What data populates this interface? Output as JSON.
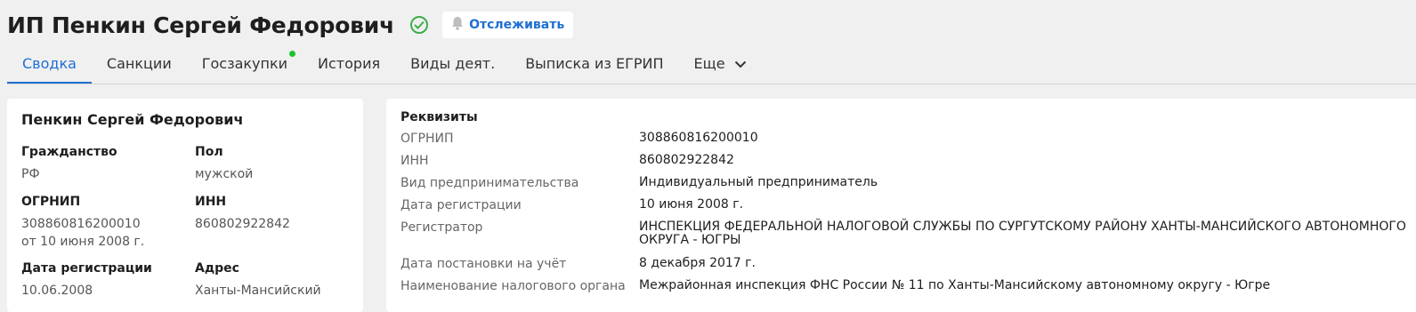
{
  "header": {
    "title": "ИП Пенкин Сергей Федорович",
    "track_label": "Отслеживать"
  },
  "tabs": [
    {
      "label": "Сводка",
      "active": true
    },
    {
      "label": "Санкции"
    },
    {
      "label": "Госзакупки",
      "indicator": true
    },
    {
      "label": "История"
    },
    {
      "label": "Виды деят."
    },
    {
      "label": "Выписка из ЕГРИП"
    },
    {
      "label": "Еще"
    }
  ],
  "person": {
    "name": "Пенкин Сергей Федорович",
    "citizenship_label": "Гражданство",
    "citizenship_value": "РФ",
    "gender_label": "Пол",
    "gender_value": "мужской",
    "ogrnip_label": "ОГРНИП",
    "ogrnip_value": "308860816200010",
    "ogrnip_date": "от 10 июня 2008 г.",
    "inn_label": "ИНН",
    "inn_value": "860802922842",
    "reg_date_label": "Дата регистрации",
    "reg_date_value": "10.06.2008",
    "address_label": "Адрес",
    "address_value": "Ханты-Мансийский"
  },
  "requisites": {
    "title": "Реквизиты",
    "rows": [
      {
        "key": "ОГРНИП",
        "value": "308860816200010"
      },
      {
        "key": "ИНН",
        "value": "860802922842"
      },
      {
        "key": "Вид предпринимательства",
        "value": "Индивидуальный предприниматель"
      },
      {
        "key": "Дата регистрации",
        "value": "10 июня 2008 г."
      },
      {
        "key": "Регистратор",
        "value_line1": "ИНСПЕКЦИЯ ФЕДЕРАЛЬНОЙ НАЛОГОВОЙ СЛУЖБЫ ПО СУРГУТСКОМУ РАЙОНУ ХАНТЫ-МАНСИЙСКОГО АВТОНОМНОГО",
        "value_line2": "ОКРУГА - ЮГРЫ"
      },
      {
        "key": "Дата постановки на учёт",
        "value": "8 декабря 2017 г."
      },
      {
        "key": "Наименование налогового органа",
        "value": "Межрайонная инспекция ФНС России № 11 по Ханты-Мансийскому автономному округу - Югре"
      }
    ]
  },
  "colors": {
    "accent": "#1f6fd1",
    "verified": "#3fae4a",
    "indicator": "#1ec22e",
    "background": "#f0f0f0"
  },
  "icons": {
    "verified": "check-circle-icon",
    "track": "bell-icon",
    "more": "chevron-down-icon"
  }
}
